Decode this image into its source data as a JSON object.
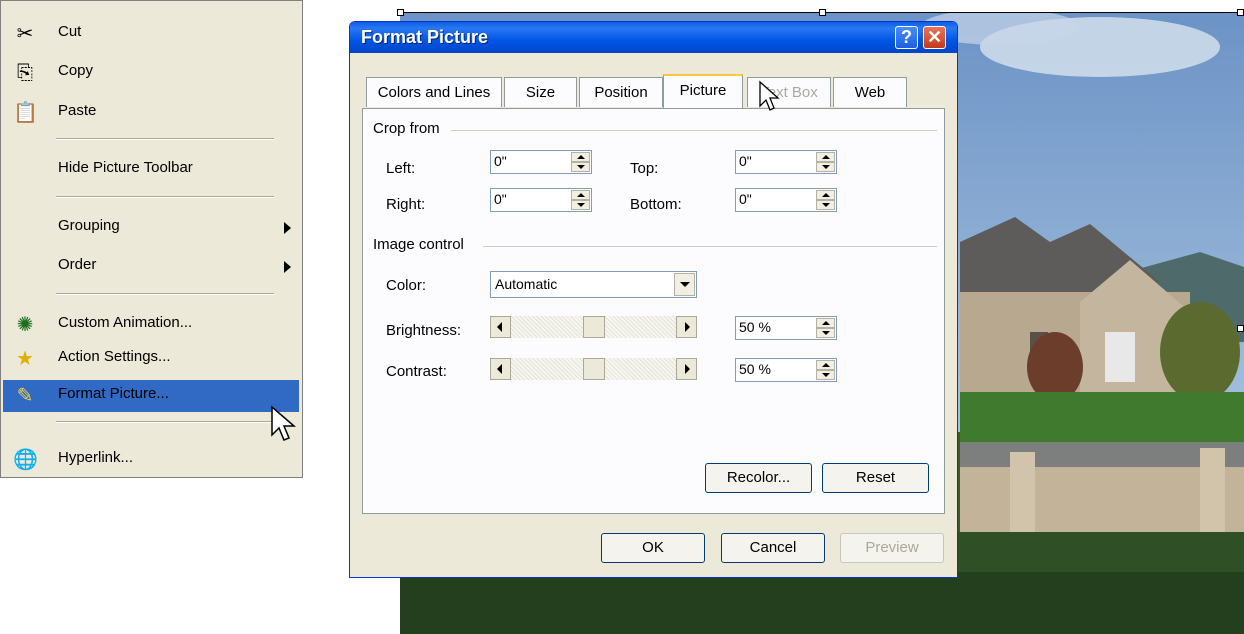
{
  "context_menu": {
    "items": [
      {
        "label": "Cut",
        "icon": "scissors-icon",
        "glyph": "✂"
      },
      {
        "label": "Copy",
        "icon": "copy-icon",
        "glyph": "⎘"
      },
      {
        "label": "Paste",
        "icon": "paste-icon",
        "glyph": "📋"
      },
      {
        "label": "Hide Picture Toolbar"
      },
      {
        "label": "Grouping"
      },
      {
        "label": "Order"
      },
      {
        "label": "Custom Animation...",
        "icon": "custom-animation-icon",
        "glyph": "✺"
      },
      {
        "label": "Action Settings...",
        "icon": "action-settings-icon",
        "glyph": "★"
      },
      {
        "label": "Format Picture...",
        "icon": "format-picture-icon",
        "glyph": "✎"
      },
      {
        "label": "Hyperlink...",
        "icon": "hyperlink-icon",
        "glyph": "🌐"
      }
    ]
  },
  "dialog": {
    "title": "Format Picture",
    "help_glyph": "?",
    "close_glyph": "✕",
    "tabs": [
      "Colors and Lines",
      "Size",
      "Position",
      "Picture",
      "Text Box",
      "Web"
    ],
    "active_tab": "Picture",
    "crop": {
      "group_label": "Crop from",
      "left_label": "Left:",
      "left_value": "0\"",
      "top_label": "Top:",
      "top_value": "0\"",
      "right_label": "Right:",
      "right_value": "0\"",
      "bottom_label": "Bottom:",
      "bottom_value": "0\""
    },
    "image_control": {
      "group_label": "Image control",
      "color_label": "Color:",
      "color_value": "Automatic",
      "brightness_label": "Brightness:",
      "brightness_value": "50 %",
      "brightness_level": 0.5,
      "contrast_label": "Contrast:",
      "contrast_value": "50 %",
      "contrast_level": 0.5
    },
    "buttons": {
      "recolor": "Recolor...",
      "reset": "Reset",
      "ok": "OK",
      "cancel": "Cancel",
      "preview": "Preview"
    }
  },
  "colors": {
    "menu_highlight": "#316ac5",
    "titlebar": "#0055e5",
    "dialog_face": "#ece9d8"
  }
}
